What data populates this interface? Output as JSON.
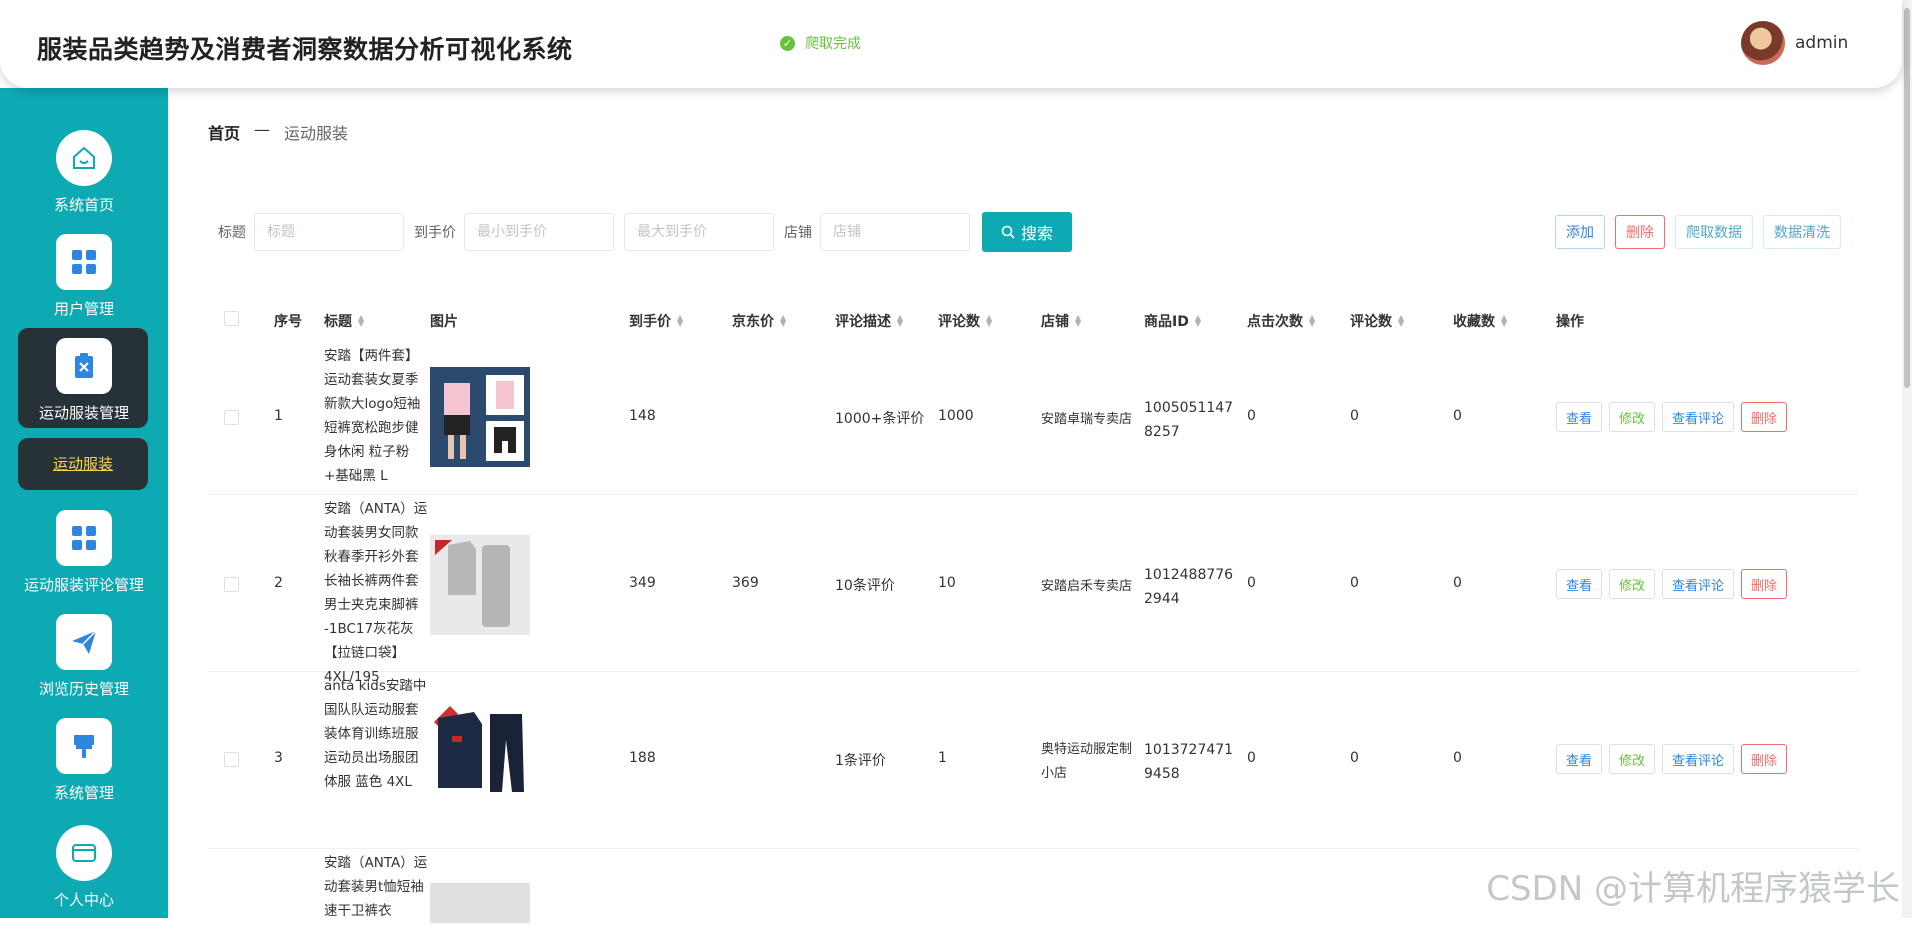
{
  "header": {
    "title": "服装品类趋势及消费者洞察数据分析可视化系统",
    "crawl_status": "爬取完成",
    "username": "admin"
  },
  "sidebar": {
    "items": [
      {
        "label": "系统首页",
        "icon": "home-icon"
      },
      {
        "label": "用户管理",
        "icon": "grid-icon"
      },
      {
        "label": "运动服装管理",
        "icon": "clipboard-x-icon"
      },
      {
        "label": "运动服装评论管理",
        "icon": "grid-icon"
      },
      {
        "label": "浏览历史管理",
        "icon": "paper-plane-icon"
      },
      {
        "label": "系统管理",
        "icon": "brush-icon"
      },
      {
        "label": "个人中心",
        "icon": "card-icon"
      }
    ],
    "active_sub_item": "运动服装"
  },
  "breadcrumb": {
    "home": "首页",
    "separator": "—",
    "current": "运动服装"
  },
  "search": {
    "title_label": "标题",
    "title_placeholder": "标题",
    "price_label": "到手价",
    "min_price_placeholder": "最小到手价",
    "max_price_placeholder": "最大到手价",
    "store_label": "店铺",
    "store_placeholder": "店铺",
    "search_button": "搜索"
  },
  "toolbar": {
    "add": "添加",
    "delete": "删除",
    "crawl": "爬取数据",
    "clean": "数据清洗"
  },
  "table": {
    "columns": [
      "序号",
      "标题",
      "图片",
      "到手价",
      "京东价",
      "评论描述",
      "评论数",
      "店铺",
      "商品ID",
      "点击次数",
      "评论数",
      "收藏数",
      "操作"
    ],
    "rows": [
      {
        "index": "1",
        "title": "安踏【两件套】运动套装女夏季新款大logo短袖短裤宽松跑步健身休闲 粒子粉+基础黑 L",
        "price": "148",
        "jd_price": "",
        "comment_desc": "1000+条评价",
        "comment_count": "1000",
        "store": "安踏卓瑞专卖店",
        "product_id": "10050511478257",
        "clicks": "0",
        "comments": "0",
        "favorites": "0"
      },
      {
        "index": "2",
        "title": "安踏（ANTA）运动套装男女同款秋春季开衫外套长袖长裤两件套男士夹克束脚裤 -1BC17灰花灰【拉链口袋】4XL/195",
        "price": "349",
        "jd_price": "369",
        "comment_desc": "10条评价",
        "comment_count": "10",
        "store": "安踏启禾专卖店",
        "product_id": "10124887762944",
        "clicks": "0",
        "comments": "0",
        "favorites": "0"
      },
      {
        "index": "3",
        "title": "anta kids安踏中国队队运动服套装体育训练班服运动员出场服团体服 蓝色 4XL",
        "price": "188",
        "jd_price": "",
        "comment_desc": "1条评价",
        "comment_count": "1",
        "store": "奥特运动服定制小店",
        "product_id": "10137274719458",
        "clicks": "0",
        "comments": "0",
        "favorites": "0"
      },
      {
        "index": "",
        "title": "安踏（ANTA）运动套装男t恤短袖速干卫裤衣",
        "price": "",
        "jd_price": "",
        "comment_desc": "",
        "comment_count": "",
        "store": "",
        "product_id": "",
        "clicks": "",
        "comments": "",
        "favorites": ""
      }
    ],
    "row_actions": {
      "view": "查看",
      "edit": "修改",
      "view_comments": "查看评论",
      "delete": "删除"
    }
  },
  "watermark": "CSDN @计算机程序猿学长",
  "colors": {
    "primary": "#0eaab4",
    "sidebar_active": "#263238",
    "success": "#67c23a",
    "danger": "#f56c6c",
    "active_text": "#ffd54f"
  }
}
